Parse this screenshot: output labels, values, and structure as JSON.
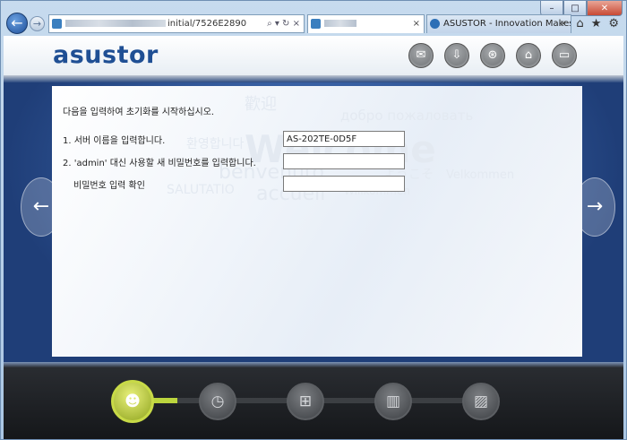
{
  "browser": {
    "address_text": "initial/7526E2890",
    "tab1_x": "×",
    "tab2_title": "ASUSTOR - Innovation Makes...",
    "tab2_x": "×",
    "caption": {
      "minimize": "–",
      "maximize": "□",
      "close": "✕"
    },
    "tools": {
      "home": "⌂",
      "favorites": "★",
      "settings": "⚙"
    },
    "address_controls": "⌕ ▾ ↻ ×"
  },
  "header": {
    "logo": "asustor",
    "icons": [
      "chat-icon",
      "download-icon",
      "support-icon",
      "bank-icon",
      "storage-icon"
    ]
  },
  "form": {
    "intro": "다음을 입력하여 초기화를 시작하십시오.",
    "server_name_label": "1. 서버 이름을 입력합니다.",
    "server_name_value": "AS-202TE-0D5F",
    "password_label": "2. 'admin' 대신 사용할 새 비밀번호를 입력합니다.",
    "confirm_label": "비밀번호 입력 확인"
  },
  "watermark": {
    "w1": "歡迎",
    "w2": "добро пожаловать",
    "w3": "환영합니다",
    "w4": "Welcome",
    "w5": "benvenuto",
    "w6": "ようこそ",
    "w7": "Velkommen",
    "w8": "SALUTATIO",
    "w9": "accueil",
    "w10": "Willkommen"
  },
  "nav": {
    "prev": "←",
    "next": "→"
  },
  "steps": [
    {
      "name": "user",
      "glyph": "👤",
      "active": true
    },
    {
      "name": "time",
      "glyph": "◷",
      "active": false
    },
    {
      "name": "network",
      "glyph": "⊞",
      "active": false
    },
    {
      "name": "disks",
      "glyph": "▥",
      "active": false
    },
    {
      "name": "storage",
      "glyph": "▨",
      "active": false
    }
  ],
  "colors": {
    "brand": "#1f4f94",
    "accent": "#bcd53e",
    "page_bg": "#1e3b73"
  }
}
